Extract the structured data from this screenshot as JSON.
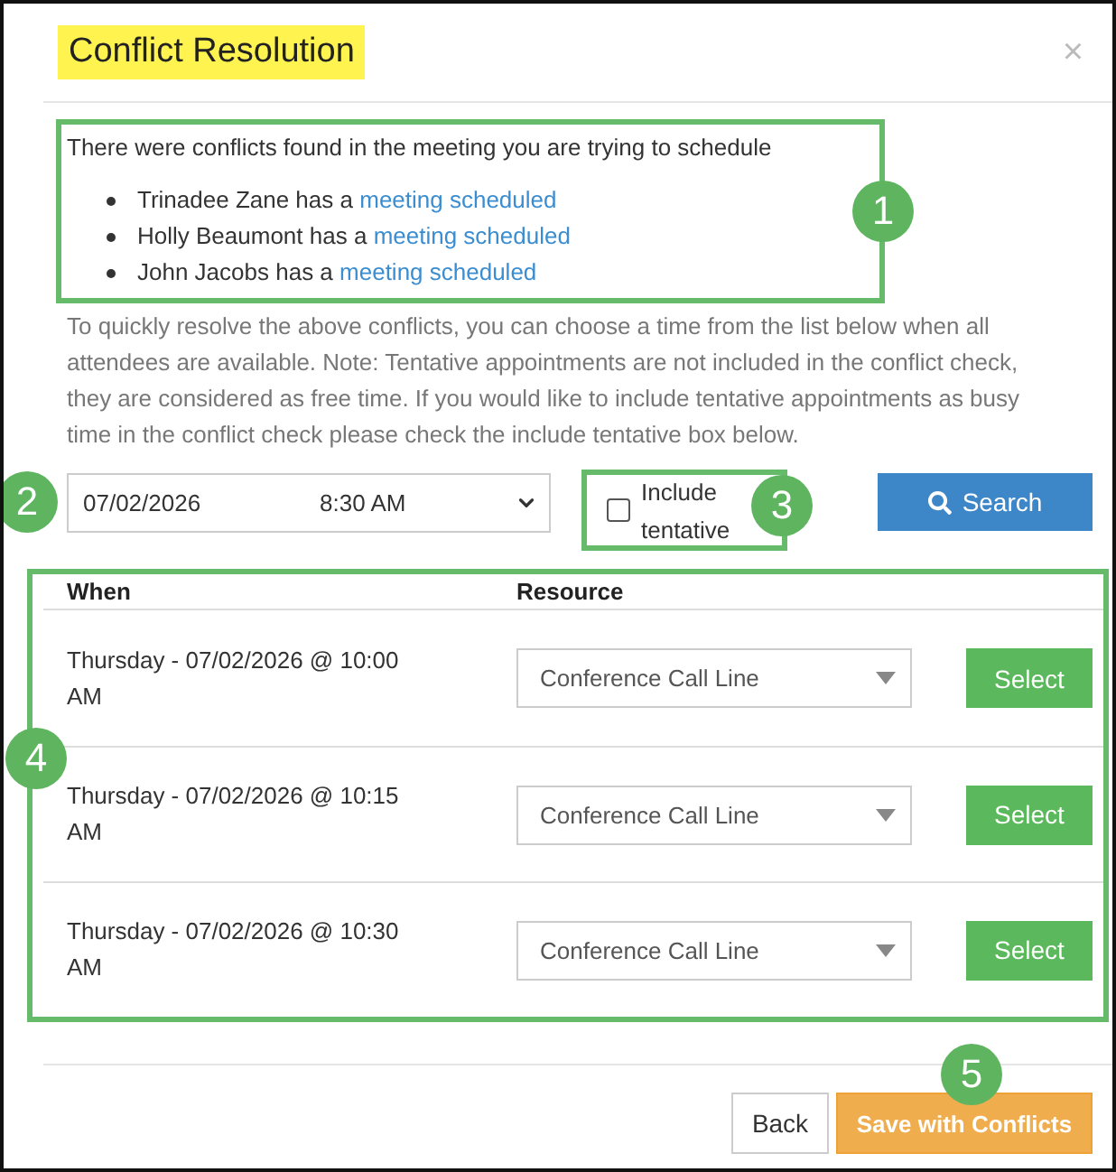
{
  "dialog": {
    "title": {
      "text": "Conflict Resolution",
      "highlighted": true
    },
    "close_label": "×"
  },
  "conflicts": {
    "framed": true,
    "callout": "1",
    "intro": "There were conflicts found in the meeting you are trying to schedule",
    "items": [
      {
        "text": "Trinadee Zane has a",
        "link": "meeting scheduled"
      },
      {
        "text": "Holly Beaumont has a",
        "link": "meeting scheduled"
      },
      {
        "text": "John Jacobs has a",
        "link": "meeting scheduled"
      }
    ]
  },
  "help_text": "To quickly resolve the above conflicts, you can choose a time from the list below when all attendees are available. Note: Tentative appointments are not included in the conflict check, they are considered as free time. If you would like to include tentative appointments as busy time in the conflict check please check the include tentative box below.",
  "search": {
    "date": "07/02/2026",
    "time": "8:30 AM",
    "date_callout": "2",
    "include_tentative": {
      "label": "Include tentative",
      "checked": false,
      "framed": true,
      "callout": "3"
    },
    "button": "Search"
  },
  "results": {
    "framed": true,
    "callout": "4",
    "columns": [
      "When",
      "Resource"
    ],
    "rows": [
      {
        "when": "Thursday - 07/02/2026 @ 10:00 AM",
        "resource": "Conference Call Line",
        "action": "Select"
      },
      {
        "when": "Thursday - 07/02/2026 @ 10:15 AM",
        "resource": "Conference Call Line",
        "action": "Select"
      },
      {
        "when": "Thursday - 07/02/2026 @ 10:30 AM",
        "resource": "Conference Call Line",
        "action": "Select"
      }
    ]
  },
  "footer": {
    "buttons": [
      {
        "label": "Back",
        "kind": "default"
      },
      {
        "label": "Save with Conflicts",
        "kind": "warning",
        "callout": "5"
      }
    ]
  }
}
